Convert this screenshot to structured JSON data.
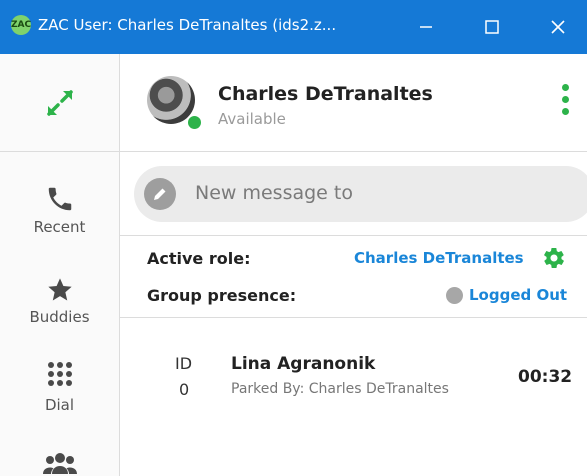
{
  "window": {
    "title": "ZAC User: Charles DeTranaltes (ids2.z...",
    "logo_text": "ZAC"
  },
  "sidebar": {
    "items": [
      {
        "label": "Recent",
        "icon": "phone-icon"
      },
      {
        "label": "Buddies",
        "icon": "star-icon"
      },
      {
        "label": "Dial",
        "icon": "dialpad-icon"
      },
      {
        "label": "",
        "icon": "group-icon"
      }
    ]
  },
  "profile": {
    "name": "Charles DeTranaltes",
    "status": "Available",
    "status_color": "#2db34a"
  },
  "message": {
    "placeholder": "New message to"
  },
  "roles": {
    "active_role_label": "Active role:",
    "active_role_value": "Charles DeTranaltes",
    "group_presence_label": "Group presence:",
    "group_presence_value": "Logged Out"
  },
  "parked_call": {
    "id_label": "ID",
    "id_value": "0",
    "caller_name": "Lina Agranonik",
    "parked_by": "Parked By: Charles DeTranaltes",
    "timer": "00:32"
  },
  "colors": {
    "accent_blue": "#1579d6",
    "link_blue": "#1a86d8",
    "green": "#2db34a"
  }
}
